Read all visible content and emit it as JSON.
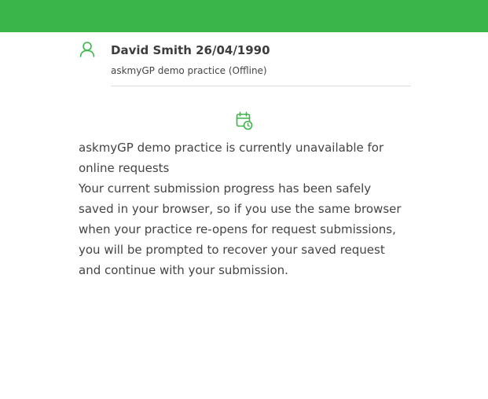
{
  "header": {
    "bar_color": "#3ab54a"
  },
  "patient": {
    "icon": "user-icon",
    "name_dob": "David Smith 26/04/1990",
    "practice_status": "askmyGP demo practice (Offline)"
  },
  "notice": {
    "icon": "calendar-clock-icon",
    "accent_color": "#3ab54a",
    "unavailable_text": "askmyGP demo practice is currently unavailable for online requests",
    "saved_text": "Your current submission progress has been safely saved in your browser, so if you use the same browser when your practice re-opens for request submissions, you will be prompted to recover your saved request and continue with your submission."
  }
}
